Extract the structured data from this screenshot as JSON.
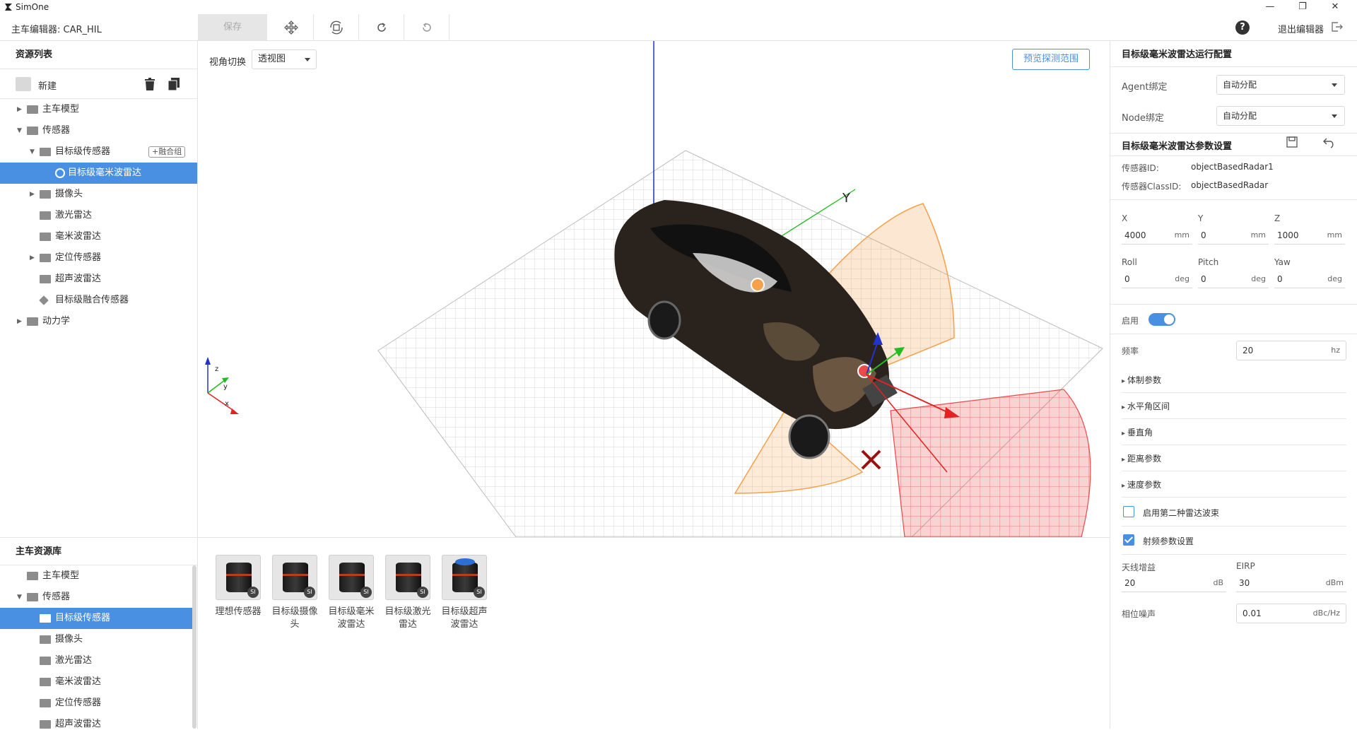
{
  "app": {
    "name": "SimOne",
    "editor_title": "主车编辑器: CAR_HIL",
    "window_controls": [
      "—",
      "❐",
      "✕"
    ]
  },
  "toolbar": {
    "save_label": "保存",
    "icons": [
      "move-icon",
      "transform-icon",
      "redo-icon",
      "undo-icon"
    ],
    "help": "?",
    "exit_label": "退出编辑器"
  },
  "left": {
    "resource_title": "资源列表",
    "new_label": "新建",
    "tree": [
      {
        "label": "主车模型",
        "level": 1,
        "arrow": "▶",
        "type": "folder"
      },
      {
        "label": "传感器",
        "level": 1,
        "arrow": "▼",
        "type": "folder-open"
      },
      {
        "label": "目标级传感器",
        "level": 2,
        "arrow": "▼",
        "type": "folder-open",
        "action": "+融合组"
      },
      {
        "label": "目标级毫米波雷达",
        "level": 3,
        "arrow": "",
        "type": "radar",
        "selected": true
      },
      {
        "label": "摄像头",
        "level": 2,
        "arrow": "▶",
        "type": "folder"
      },
      {
        "label": "激光雷达",
        "level": 2,
        "arrow": "",
        "type": "folder"
      },
      {
        "label": "毫米波雷达",
        "level": 2,
        "arrow": "",
        "type": "folder"
      },
      {
        "label": "定位传感器",
        "level": 2,
        "arrow": "▶",
        "type": "folder"
      },
      {
        "label": "超声波雷达",
        "level": 2,
        "arrow": "",
        "type": "folder"
      },
      {
        "label": "目标级融合传感器",
        "level": 2,
        "arrow": "",
        "type": "fusion"
      },
      {
        "label": "动力学",
        "level": 1,
        "arrow": "▶",
        "type": "folder"
      }
    ],
    "library_title": "主车资源库",
    "library_tree": [
      {
        "label": "主车模型",
        "level": 1,
        "arrow": "",
        "type": "folder"
      },
      {
        "label": "传感器",
        "level": 1,
        "arrow": "▼",
        "type": "folder-open"
      },
      {
        "label": "目标级传感器",
        "level": 2,
        "arrow": "",
        "type": "folder",
        "selected": true
      },
      {
        "label": "摄像头",
        "level": 2,
        "arrow": "",
        "type": "folder"
      },
      {
        "label": "激光雷达",
        "level": 2,
        "arrow": "",
        "type": "folder"
      },
      {
        "label": "毫米波雷达",
        "level": 2,
        "arrow": "",
        "type": "folder"
      },
      {
        "label": "定位传感器",
        "level": 2,
        "arrow": "",
        "type": "folder"
      },
      {
        "label": "超声波雷达",
        "level": 2,
        "arrow": "",
        "type": "folder"
      }
    ]
  },
  "viewport": {
    "view_label": "视角切换",
    "view_value": "透视图",
    "preview_btn": "预览探测范围",
    "axis_labels": {
      "x": "x",
      "y": "y",
      "z": "z",
      "gizmo_y": "Y"
    }
  },
  "assets": [
    {
      "label": "理想传感器",
      "badge": "SI",
      "blue": false
    },
    {
      "label": "目标级摄像头",
      "badge": "SI",
      "blue": false
    },
    {
      "label": "目标级毫米波雷达",
      "badge": "SI",
      "blue": false
    },
    {
      "label": "目标级激光雷达",
      "badge": "SI",
      "blue": false
    },
    {
      "label": "目标级超声波雷达",
      "badge": "SI",
      "blue": true
    }
  ],
  "right": {
    "run_config_title": "目标级毫米波雷达运行配置",
    "agent_label": "Agent绑定",
    "agent_value": "自动分配",
    "node_label": "Node绑定",
    "node_value": "自动分配",
    "param_title": "目标级毫米波雷达参数设置",
    "sensor_id_label": "传感器ID:",
    "sensor_id_value": "objectBasedRadar1",
    "class_id_label": "传感器ClassID:",
    "class_id_value": "objectBasedRadar",
    "pos": [
      {
        "label": "X",
        "value": "4000",
        "unit": "mm"
      },
      {
        "label": "Y",
        "value": "0",
        "unit": "mm"
      },
      {
        "label": "Z",
        "value": "1000",
        "unit": "mm"
      }
    ],
    "rot": [
      {
        "label": "Roll",
        "value": "0",
        "unit": "deg"
      },
      {
        "label": "Pitch",
        "value": "0",
        "unit": "deg"
      },
      {
        "label": "Yaw",
        "value": "0",
        "unit": "deg"
      }
    ],
    "enable_label": "启用",
    "enable_on": true,
    "freq_label": "频率",
    "freq_value": "20",
    "freq_unit": "hz",
    "collapsibles": [
      "体制参数",
      "水平角区间",
      "垂直角",
      "距离参数",
      "速度参数"
    ],
    "second_beam_label": "启用第二种雷达波束",
    "second_beam_checked": false,
    "rf_label": "射频参数设置",
    "rf_checked": true,
    "gain_label": "天线增益",
    "gain_value": "20",
    "gain_unit": "dB",
    "eirp_label": "EIRP",
    "eirp_value": "30",
    "eirp_unit": "dBm",
    "phase_label": "相位噪声",
    "phase_value": "0.01",
    "phase_unit": "dBc/Hz"
  },
  "colors": {
    "accent": "#4a90e2",
    "selected_row": "#4a90e2",
    "fov_orange": "#f5a04a",
    "fov_red": "#e94b4b"
  }
}
